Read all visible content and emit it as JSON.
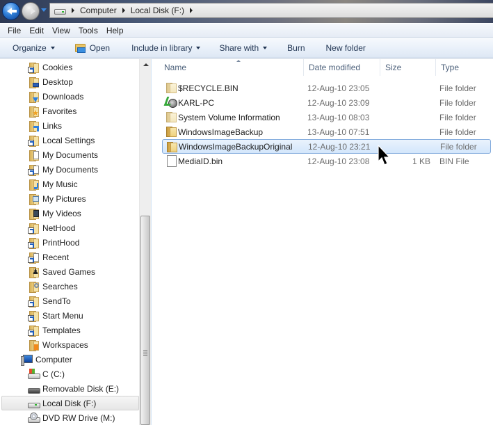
{
  "address": {
    "breadcrumbs": [
      "Computer",
      "Local Disk (F:)"
    ]
  },
  "menu": [
    "File",
    "Edit",
    "View",
    "Tools",
    "Help"
  ],
  "toolbar": {
    "organize": "Organize",
    "open": "Open",
    "include_in_library": "Include in library",
    "share_with": "Share with",
    "burn": "Burn",
    "new_folder": "New folder"
  },
  "nav": {
    "items": [
      {
        "label": "Cookies",
        "icon": "folder-shortcut-icon"
      },
      {
        "label": "Desktop",
        "icon": "desktop-folder-icon"
      },
      {
        "label": "Downloads",
        "icon": "downloads-folder-icon"
      },
      {
        "label": "Favorites",
        "icon": "favorites-folder-icon"
      },
      {
        "label": "Links",
        "icon": "links-folder-icon"
      },
      {
        "label": "Local Settings",
        "icon": "folder-shortcut-icon"
      },
      {
        "label": "My Documents",
        "icon": "documents-folder-icon"
      },
      {
        "label": "My Documents",
        "icon": "documents-shortcut-icon"
      },
      {
        "label": "My Music",
        "icon": "music-folder-icon"
      },
      {
        "label": "My Pictures",
        "icon": "pictures-folder-icon"
      },
      {
        "label": "My Videos",
        "icon": "videos-folder-icon"
      },
      {
        "label": "NetHood",
        "icon": "folder-shortcut-icon"
      },
      {
        "label": "PrintHood",
        "icon": "folder-shortcut-icon"
      },
      {
        "label": "Recent",
        "icon": "recent-shortcut-icon"
      },
      {
        "label": "Saved Games",
        "icon": "saved-games-folder-icon"
      },
      {
        "label": "Searches",
        "icon": "searches-folder-icon"
      },
      {
        "label": "SendTo",
        "icon": "folder-shortcut-icon"
      },
      {
        "label": "Start Menu",
        "icon": "folder-shortcut-icon"
      },
      {
        "label": "Templates",
        "icon": "folder-shortcut-icon"
      },
      {
        "label": "Workspaces",
        "icon": "workspaces-folder-icon"
      },
      {
        "label": "Computer",
        "icon": "computer-icon"
      },
      {
        "label": "C (C:)",
        "icon": "system-drive-icon"
      },
      {
        "label": "Removable Disk (E:)",
        "icon": "removable-drive-icon"
      },
      {
        "label": "Local Disk (F:)",
        "icon": "local-drive-icon",
        "selected": true
      },
      {
        "label": "DVD RW Drive (M:)",
        "icon": "dvd-drive-icon"
      }
    ]
  },
  "columns": {
    "name": "Name",
    "date": "Date modified",
    "size": "Size",
    "type": "Type"
  },
  "files": [
    {
      "name": "$RECYCLE.BIN",
      "date": "12-Aug-10 23:05",
      "size": "",
      "type": "File folder",
      "icon": "folder-icon"
    },
    {
      "name": "KARL-PC",
      "date": "12-Aug-10 23:09",
      "size": "",
      "type": "File folder",
      "icon": "network-user-folder-icon"
    },
    {
      "name": "System Volume Information",
      "date": "13-Aug-10 08:03",
      "size": "",
      "type": "File folder",
      "icon": "folder-icon"
    },
    {
      "name": "WindowsImageBackup",
      "date": "13-Aug-10 07:51",
      "size": "",
      "type": "File folder",
      "icon": "folder-icon"
    },
    {
      "name": "WindowsImageBackupOriginal",
      "date": "12-Aug-10 23:21",
      "size": "",
      "type": "File folder",
      "icon": "folder-icon",
      "selected": true
    },
    {
      "name": "MediaID.bin",
      "date": "12-Aug-10 23:08",
      "size": "1 KB",
      "type": "BIN File",
      "icon": "file-icon"
    }
  ]
}
